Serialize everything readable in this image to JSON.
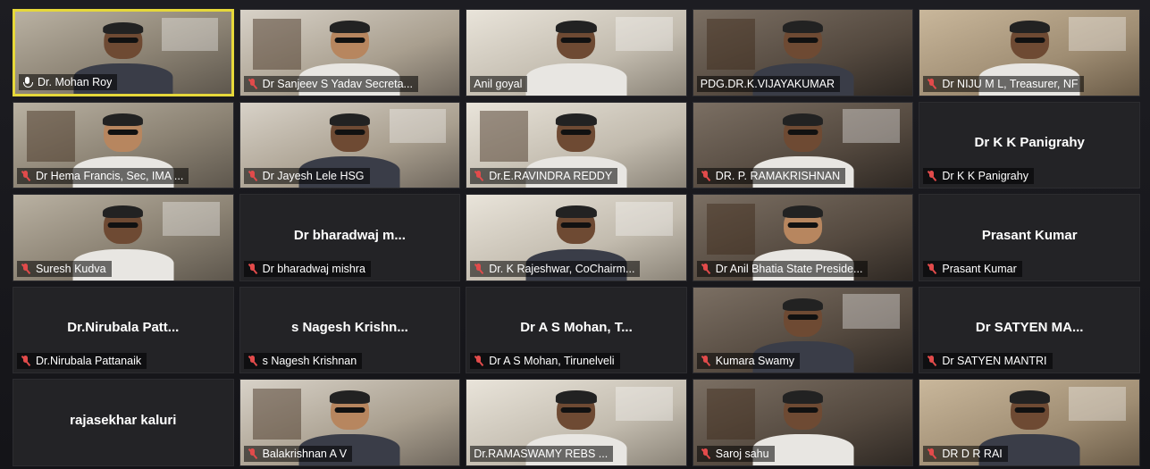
{
  "meeting": {
    "tiles": [
      {
        "name": "Dr. Mohan Roy",
        "mic": "on",
        "video": true,
        "active": true
      },
      {
        "name": "Dr Sanjeev S Yadav Secreta...",
        "mic": "muted",
        "video": true
      },
      {
        "name": "Anil  goyal",
        "mic": "none",
        "video": true
      },
      {
        "name": "PDG.DR.K.VIJAYAKUMAR",
        "mic": "none",
        "video": true
      },
      {
        "name": "Dr NIJU M L, Treasurer, NF",
        "mic": "muted",
        "video": true
      },
      {
        "name": "Dr Hema Francis, Sec, IMA ...",
        "mic": "muted",
        "video": true
      },
      {
        "name": "Dr Jayesh Lele HSG",
        "mic": "muted",
        "video": true
      },
      {
        "name": "Dr.E.RAVINDRA REDDY",
        "mic": "muted",
        "video": true
      },
      {
        "name": "DR. P. RAMAKRISHNAN",
        "mic": "muted",
        "video": true
      },
      {
        "name": "Dr K K Panigrahy",
        "center": "Dr K K Panigrahy",
        "mic": "muted",
        "video": false
      },
      {
        "name": "Suresh Kudva",
        "mic": "muted",
        "video": true
      },
      {
        "name": "Dr bharadwaj mishra",
        "center": "Dr bharadwaj m...",
        "mic": "muted",
        "video": false
      },
      {
        "name": "Dr. K Rajeshwar, CoChairm...",
        "mic": "muted",
        "video": true
      },
      {
        "name": "Dr Anil Bhatia State Preside...",
        "mic": "muted",
        "video": true
      },
      {
        "name": "Prasant Kumar",
        "center": "Prasant Kumar",
        "mic": "muted",
        "video": false
      },
      {
        "name": "Dr.Nirubala Pattanaik",
        "center": "Dr.Nirubala Patt...",
        "mic": "muted",
        "video": false
      },
      {
        "name": "s Nagesh Krishnan",
        "center": "s Nagesh Krishn...",
        "mic": "muted",
        "video": false
      },
      {
        "name": "Dr A S Mohan, Tirunelveli",
        "center": "Dr A S Mohan, T...",
        "mic": "muted",
        "video": false
      },
      {
        "name": "Kumara Swamy",
        "mic": "muted",
        "video": true
      },
      {
        "name": "Dr SATYEN MANTRI",
        "center": "Dr SATYEN MA...",
        "mic": "muted",
        "video": false
      },
      {
        "name": "",
        "center": "rajasekhar kaluri",
        "mic": "none",
        "video": false
      },
      {
        "name": "Balakrishnan A V",
        "mic": "muted",
        "video": true
      },
      {
        "name": "Dr.RAMASWAMY REBS ...",
        "mic": "none",
        "video": true
      },
      {
        "name": "Saroj sahu",
        "mic": "muted",
        "video": true
      },
      {
        "name": "DR D R RAI",
        "mic": "muted",
        "video": true
      }
    ]
  },
  "colors": {
    "active_border": "#e6d83a",
    "muted_icon": "#e24b4b"
  }
}
